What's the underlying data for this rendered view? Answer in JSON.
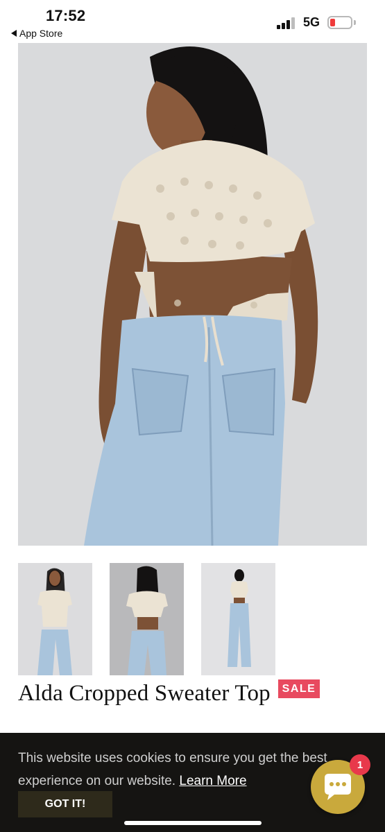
{
  "status_bar": {
    "time": "17:52",
    "back_app": "App Store",
    "network": "5G"
  },
  "product": {
    "title": "Alda Cropped Sweater Top",
    "badge": "SALE",
    "main_image": "model-back-view-photo",
    "thumbnails": [
      "front-view-photo",
      "back-view-photo",
      "full-back-view-photo"
    ]
  },
  "cookie_banner": {
    "text": "This website uses cookies to ensure you get the best experience on our website.",
    "learn_more": "Learn More",
    "button": "GOT IT!"
  },
  "chat": {
    "icon": "chat-bubble-icon",
    "badge_count": "1"
  },
  "colors": {
    "sale": "#e84a5f",
    "chat_button": "#c9a93c",
    "banner_bg": "#151412",
    "got_it_bg": "#2e2a1b"
  }
}
